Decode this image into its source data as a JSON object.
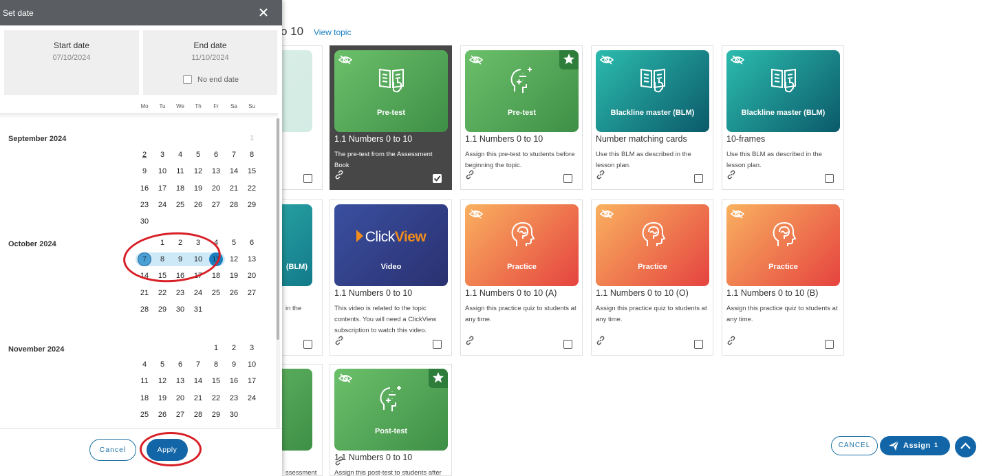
{
  "topic": {
    "title_partial": "o 10",
    "view_topic": "View topic"
  },
  "cards": [
    {
      "title": "",
      "desc": "",
      "thumb_label": "",
      "theme": "paleteal",
      "icon": "book-hand-icon"
    },
    {
      "title": "1.1 Numbers 0 to 10",
      "desc": "The pre-test from the Assessment Book",
      "thumb_label": "Pre-test",
      "theme": "green",
      "icon": "book-hand-icon",
      "hidden": true,
      "selected": true
    },
    {
      "title": "1.1 Numbers 0 to 10",
      "desc": "Assign this pre-test to students before beginning the topic.",
      "thumb_label": "Pre-test",
      "theme": "green",
      "icon": "head-math-icon",
      "hidden": true,
      "star": true
    },
    {
      "title": "Number matching cards",
      "desc": "Use this BLM as described in the lesson plan.",
      "thumb_label": "Blackline master (BLM)",
      "theme": "teal",
      "icon": "book-hand-icon",
      "hidden": true
    },
    {
      "title": "10-frames",
      "desc": "Use this BLM as described in the lesson plan.",
      "thumb_label": "Blackline master (BLM)",
      "theme": "teal",
      "icon": "book-hand-icon",
      "hidden": true
    },
    {
      "title": "",
      "desc": "in the",
      "thumb_label": "(BLM)",
      "theme": "paleblue"
    },
    {
      "title": "1.1 Numbers 0 to 10",
      "desc": "This video is related to the topic contents. You will need a ClickView subscription to watch this video.",
      "thumb_label": "Video",
      "theme": "navy",
      "logo_a": "Click",
      "logo_b": "View"
    },
    {
      "title": "1.1 Numbers 0 to 10 (A)",
      "desc": "Assign this practice quiz to students at any time.",
      "thumb_label": "Practice",
      "theme": "orange",
      "icon": "head-brain-icon",
      "hidden": true
    },
    {
      "title": "1.1 Numbers 0 to 10 (O)",
      "desc": "Assign this practice quiz to students at any time.",
      "thumb_label": "Practice",
      "theme": "orange",
      "icon": "head-brain-icon",
      "hidden": true
    },
    {
      "title": "1.1 Numbers 0 to 10 (B)",
      "desc": "Assign this practice quiz to students at any time.",
      "thumb_label": "Practice",
      "theme": "orange",
      "icon": "head-brain-icon",
      "hidden": true
    },
    {
      "title": "",
      "desc": "ssessment",
      "thumb_label": "",
      "theme": "green"
    },
    {
      "title": "1.1 Numbers 0 to 10",
      "desc": "Assign this post-test to students after",
      "thumb_label": "Post-test",
      "theme": "green",
      "icon": "head-math-icon",
      "hidden": true,
      "star": true
    }
  ],
  "actions": {
    "cancel": "CANCEL",
    "assign": "Assign",
    "assign_count": "1"
  },
  "panel": {
    "title": "Set date",
    "start_label": "Start date",
    "start_value": "07/10/2024",
    "end_label": "End date",
    "end_value": "11/10/2024",
    "no_end_date": "No end date",
    "weekdays": [
      "Mo",
      "Tu",
      "We",
      "Th",
      "Fr",
      "Sa",
      "Su"
    ],
    "months": [
      {
        "label": "September 2024",
        "weeks": [
          [
            null,
            null,
            null,
            null,
            null,
            null,
            "1"
          ],
          [
            "2",
            "3",
            "4",
            "5",
            "6",
            "7",
            "8"
          ],
          [
            "9",
            "10",
            "11",
            "12",
            "13",
            "14",
            "15"
          ],
          [
            "16",
            "17",
            "18",
            "19",
            "20",
            "21",
            "22"
          ],
          [
            "23",
            "24",
            "25",
            "26",
            "27",
            "28",
            "29"
          ],
          [
            "30",
            null,
            null,
            null,
            null,
            null,
            null
          ]
        ]
      },
      {
        "label": "October 2024",
        "weeks": [
          [
            null,
            "1",
            "2",
            "3",
            "4",
            "5",
            "6"
          ],
          [
            "7",
            "8",
            "9",
            "10",
            "11",
            "12",
            "13"
          ],
          [
            "14",
            "15",
            "16",
            "17",
            "18",
            "19",
            "20"
          ],
          [
            "21",
            "22",
            "23",
            "24",
            "25",
            "26",
            "27"
          ],
          [
            "28",
            "29",
            "30",
            "31",
            null,
            null,
            null
          ]
        ]
      },
      {
        "label": "November 2024",
        "weeks": [
          [
            null,
            null,
            null,
            null,
            "1",
            "2",
            "3"
          ],
          [
            "4",
            "5",
            "6",
            "7",
            "8",
            "9",
            "10"
          ],
          [
            "11",
            "12",
            "13",
            "14",
            "15",
            "16",
            "17"
          ],
          [
            "18",
            "19",
            "20",
            "21",
            "22",
            "23",
            "24"
          ],
          [
            "25",
            "26",
            "27",
            "28",
            "29",
            "30",
            null
          ]
        ]
      }
    ],
    "cancel": "Cancel",
    "apply": "Apply"
  },
  "colors": {
    "accent": "#1266a8",
    "annotation": "#d81f26",
    "range": "#cde8f7"
  }
}
